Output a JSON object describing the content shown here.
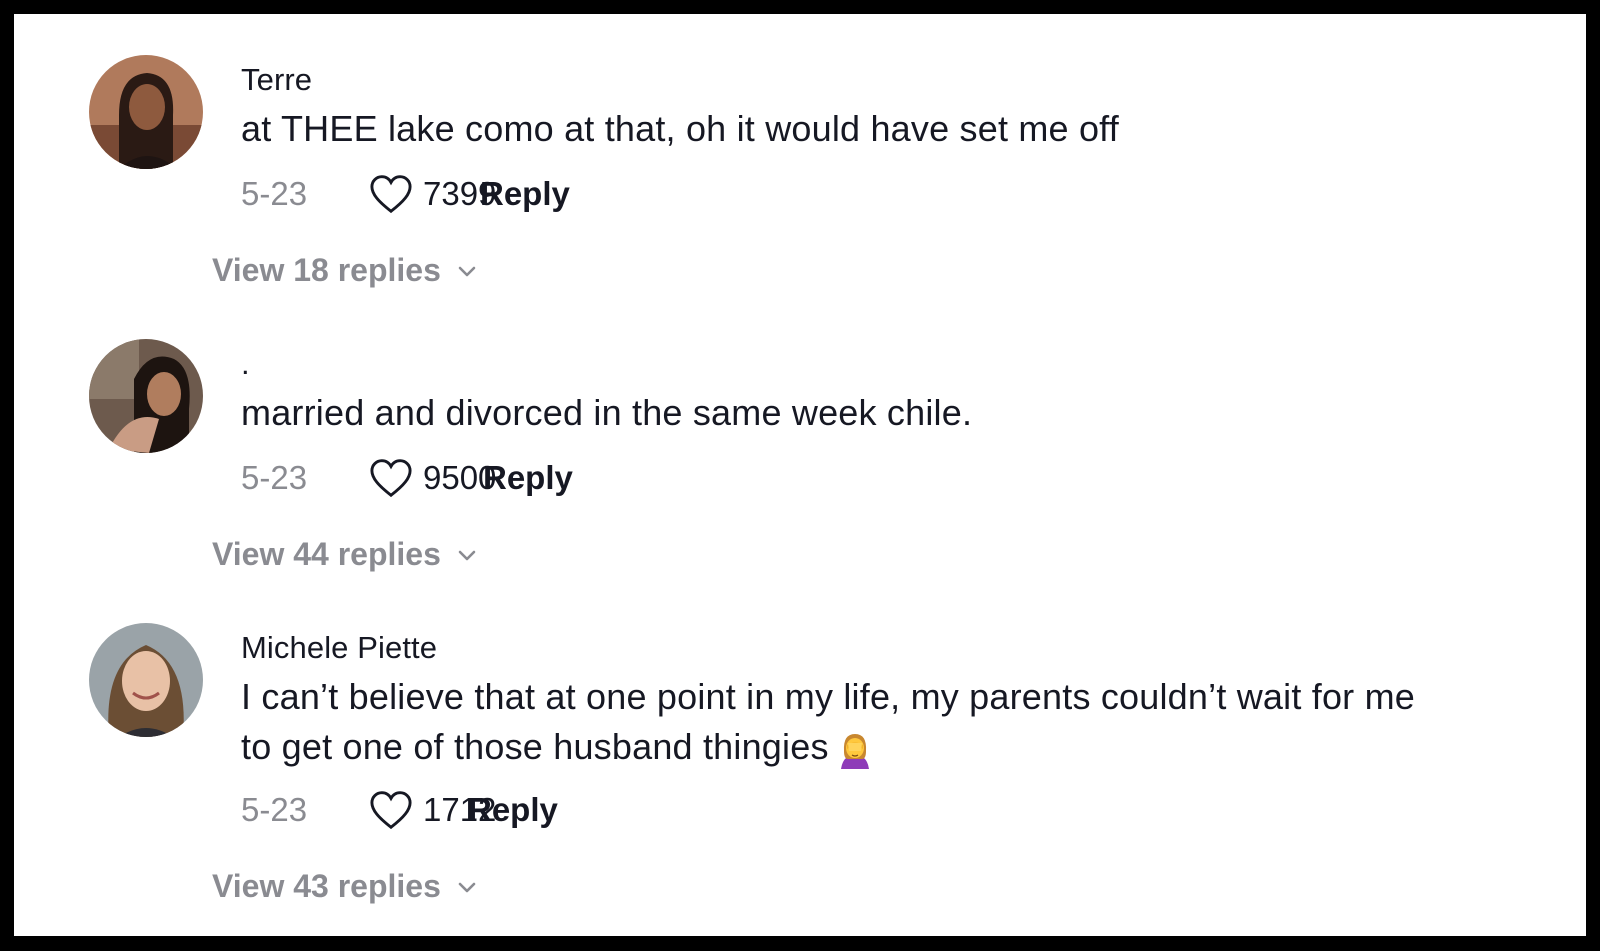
{
  "comments": [
    {
      "username": "Terre",
      "text": "at THEE lake como at that, oh it would have set me off",
      "date": "5-23",
      "likes": "7399",
      "reply_label": "Reply",
      "view_replies": "View 18 replies"
    },
    {
      "username": ".",
      "text": "married and divorced in the same week chile.",
      "date": "5-23",
      "likes": "9500",
      "reply_label": "Reply",
      "view_replies": "View 44 replies"
    },
    {
      "username": "Michele Piette",
      "text_line1": "I can’t believe that at one point in my life, my parents couldn’t wait for me",
      "text_line2": "to get one of those husband thingies",
      "date": "5-23",
      "likes": "1712",
      "reply_label": "Reply",
      "view_replies": "View 43 replies",
      "emoji": "face-palm-emoji"
    }
  ],
  "colors": {
    "text_primary": "#161823",
    "text_secondary": "#8a8b91",
    "background": "#ffffff",
    "frame_border": "#000000"
  },
  "icons": {
    "like": "heart-outline-icon",
    "expand": "chevron-down-icon"
  }
}
